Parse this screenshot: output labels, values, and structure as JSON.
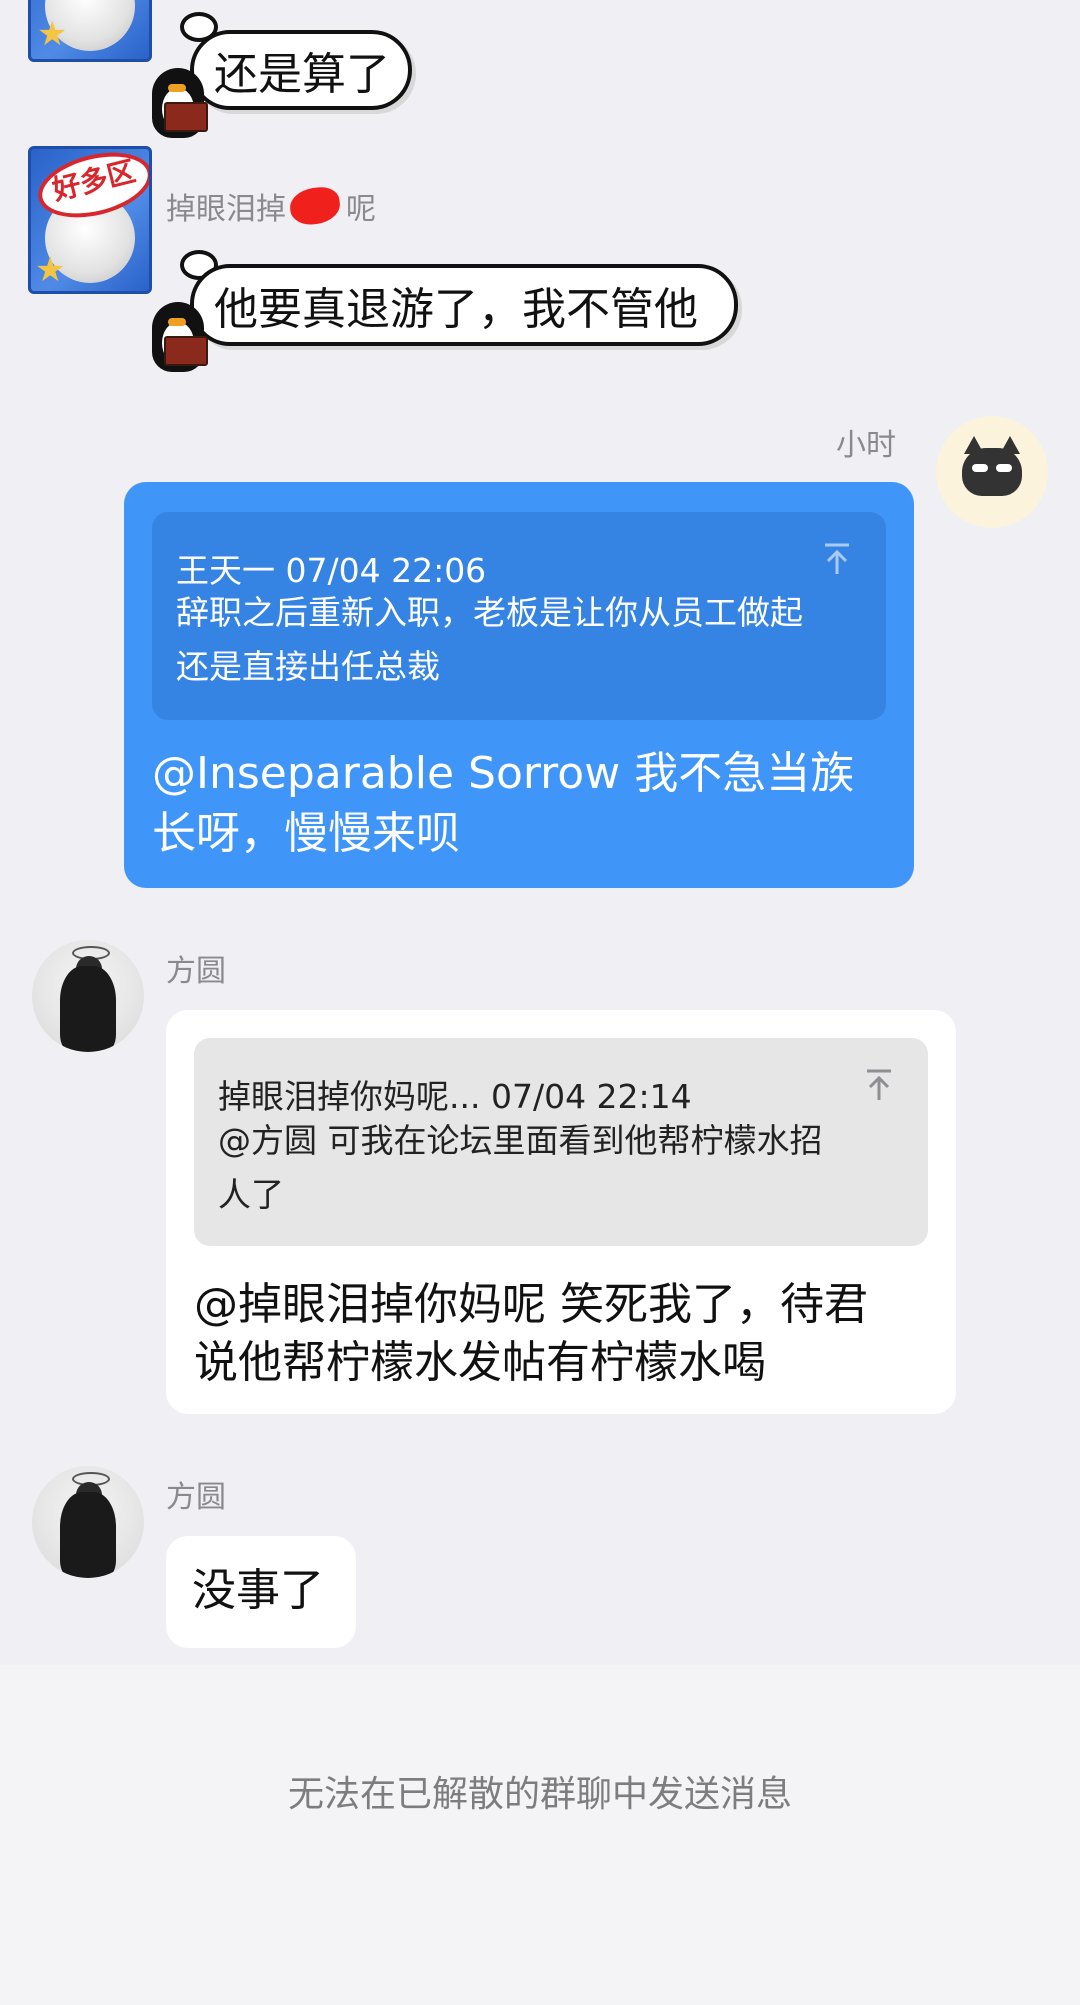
{
  "messages": [
    {
      "id": "m1",
      "sticker_text": "还是算了"
    },
    {
      "id": "m2",
      "sender": {
        "name_part1": "掉眼泪掉",
        "name_part2": "呢",
        "avatar_badge": "好多区"
      },
      "sticker_text": "他要真退游了，我不管他"
    },
    {
      "id": "m3",
      "sender": {
        "name": "小时"
      },
      "quote": {
        "meta": "王天一 07/04 22:06",
        "line1": "辞职之后重新入职，老板是让你从员工做起",
        "line2": "还是直接出任总裁"
      },
      "text_line1": "@Inseparable Sorrow 我不急当族",
      "text_line2": "长呀，慢慢来呗"
    },
    {
      "id": "m4",
      "sender": {
        "name": "方圆"
      },
      "quote": {
        "meta": "掉眼泪掉你妈呢... 07/04 22:14",
        "line1": "@方圆 可我在论坛里面看到他帮柠檬水招",
        "line2": "人了"
      },
      "text_line1": "@掉眼泪掉你妈呢 笑死我了，待君",
      "text_line2": "说他帮柠檬水发帖有柠檬水喝"
    },
    {
      "id": "m5",
      "sender": {
        "name": "方圆"
      },
      "text": "没事了"
    }
  ],
  "footer": {
    "notice": "无法在已解散的群聊中发送消息"
  },
  "colors": {
    "background": "#efeff4",
    "self_bubble": "#3f95f8",
    "self_quote": "#3584e4",
    "other_bubble": "#ffffff",
    "other_quote": "#e6e6e6",
    "redaction": "#f0201d"
  }
}
